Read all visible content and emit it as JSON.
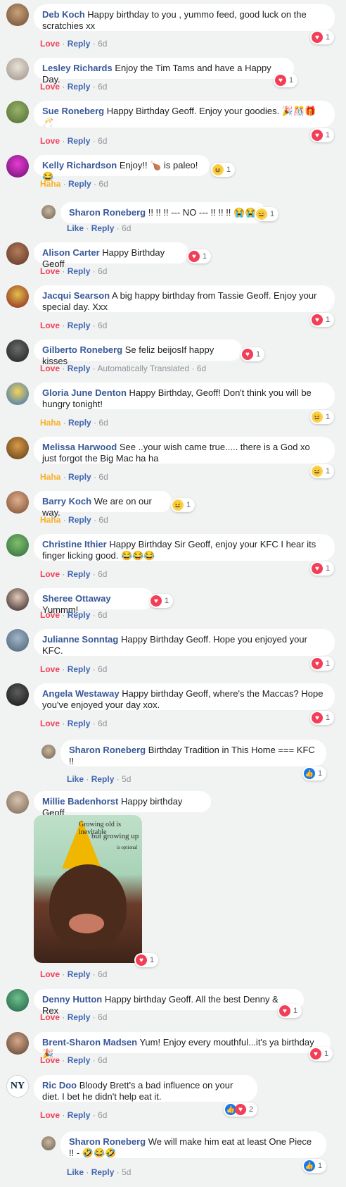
{
  "labels": {
    "reply": "Reply",
    "dot": "·"
  },
  "colors": {
    "love": "#f33e58",
    "haha": "#f7b125",
    "like": "#4267b2",
    "name": "#385898"
  },
  "comments": [
    {
      "author": "Deb Koch",
      "text": "Happy birthday to you , yummo feed, good luck on the scratchies xx",
      "reaction": "Love",
      "time": "6d",
      "count": "1"
    },
    {
      "author": "Lesley Richards",
      "text": "Enjoy the Tim Tams and have a Happy Day.",
      "reaction": "Love",
      "time": "6d",
      "count": "1"
    },
    {
      "author": "Sue Roneberg",
      "text": "Happy Birthday Geoff. Enjoy your goodies. 🎉🎊🎁🥂",
      "reaction": "Love",
      "time": "6d",
      "count": "1"
    },
    {
      "author": "Kelly Richardson",
      "text": "Enjoy!! 🍗 is paleo! 😂",
      "reaction": "Haha",
      "time": "6d",
      "count": "1"
    },
    {
      "author": "Sharon Roneberg",
      "text": "!! !! !! --- NO --- !! !! !! 😭😭",
      "reaction": "Like",
      "time": "6d",
      "count": "1"
    },
    {
      "author": "Alison Carter",
      "text": "Happy Birthday Geoff",
      "reaction": "Love",
      "time": "6d",
      "count": "1"
    },
    {
      "author": "Jacqui Searson",
      "text": "A big happy birthday from Tassie Geoff. Enjoy your special day. Xxx",
      "reaction": "Love",
      "time": "6d",
      "count": "1"
    },
    {
      "author": "Gilberto Roneberg",
      "text": "Se feliz beijosIf happy kisses",
      "reaction": "Love",
      "time": "6d",
      "translated": "Automatically Translated",
      "count": "1"
    },
    {
      "author": "Gloria June Denton",
      "text": "Happy Birthday, Geoff! Don't think you will be hungry tonight!",
      "reaction": "Haha",
      "time": "6d",
      "count": "1"
    },
    {
      "author": "Melissa Harwood",
      "text": "See ..your wish came true..... there is a God xo just forgot the Big Mac ha ha",
      "reaction": "Haha",
      "time": "6d",
      "count": "1"
    },
    {
      "author": "Barry Koch",
      "text": "We are on our way.",
      "reaction": "Haha",
      "time": "6d",
      "count": "1"
    },
    {
      "author": "Christine Ithier",
      "text": "Happy Birthday Sir Geoff, enjoy your KFC I hear its finger licking good. 😂😂😂",
      "reaction": "Love",
      "time": "6d",
      "count": "1"
    },
    {
      "author": "Sheree Ottaway",
      "text": "Yummm!",
      "reaction": "Love",
      "time": "6d",
      "count": "1"
    },
    {
      "author": "Julianne Sonntag",
      "text": "Happy Birthday Geoff. Hope you enjoyed your KFC.",
      "reaction": "Love",
      "time": "6d",
      "count": "1"
    },
    {
      "author": "Angela Westaway",
      "text": "Happy birthday Geoff, where's the Maccas? Hope you've enjoyed your day xox.",
      "reaction": "Love",
      "time": "6d",
      "count": "1"
    },
    {
      "author": "Sharon Roneberg",
      "text": "Birthday Tradition in This Home === KFC !!",
      "reaction": "Like",
      "time": "5d",
      "count": "1"
    },
    {
      "author": "Millie Badenhorst",
      "text": "Happy birthday Geoff",
      "reaction": "Love",
      "time": "6d",
      "count": "1"
    },
    {
      "author": "Denny Hutton",
      "text": "Happy birthday Geoff. All the best Denny & Rex",
      "reaction": "Love",
      "time": "6d",
      "count": "1"
    },
    {
      "author": "Brent-Sharon Madsen",
      "text": "Yum! Enjoy every mouthful...it's ya birthday 🎉",
      "reaction": "Love",
      "time": "6d",
      "count": "1"
    },
    {
      "author": "Ric Doo",
      "text": "Bloody Brett's a bad influence on your diet. I bet he didn't help eat it.",
      "reaction": "Love",
      "time": "6d",
      "count": "2"
    },
    {
      "author": "Sharon Roneberg",
      "text": "We will make him eat at least One Piece !! - 🤣😂🤣",
      "reaction": "Like",
      "time": "5d",
      "count": "1"
    }
  ],
  "photo": {
    "line1": "Growing old is inevitable",
    "line2": "but growing up",
    "line3": "is optional"
  }
}
